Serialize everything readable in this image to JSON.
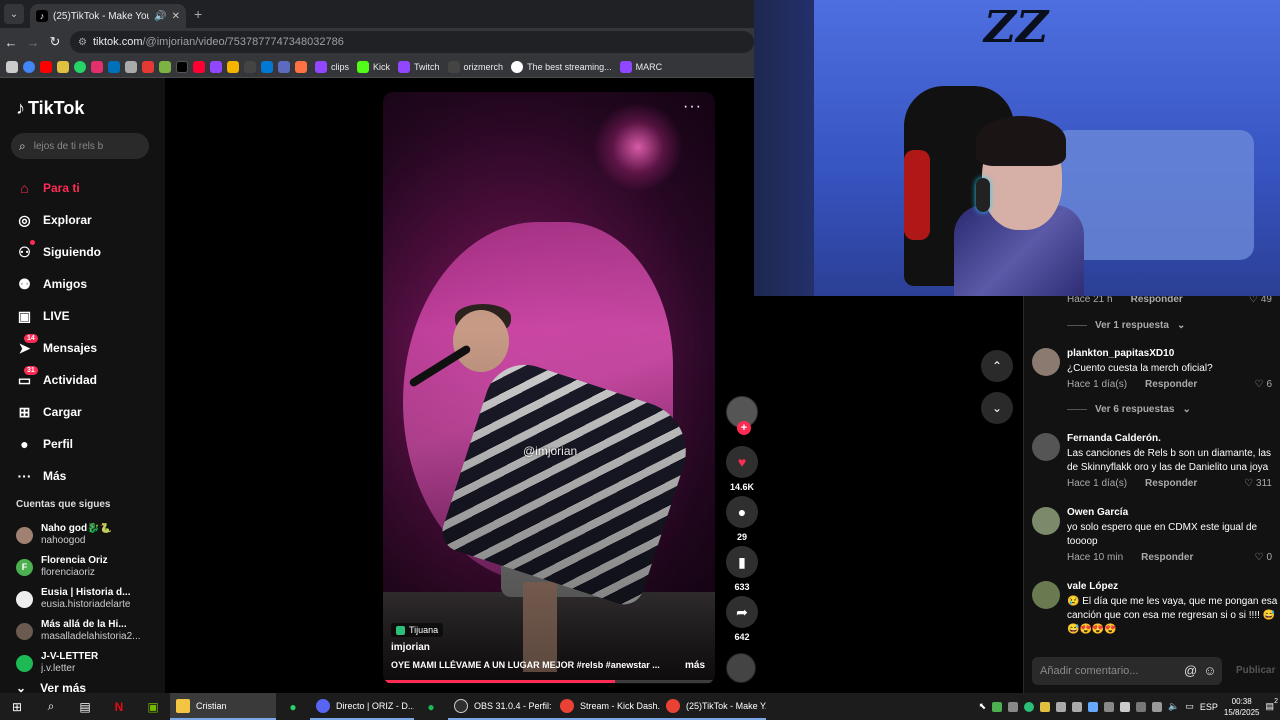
{
  "browser": {
    "tab_title": "(25)TikTok - Make Your Day",
    "url_main": "tiktok.com",
    "url_rest": "/@imjorian/video/7537877747348032786",
    "bookmarks": [
      "clips",
      "Kick",
      "Twitch",
      "orizmerch",
      "The best streaming...",
      "MARC"
    ]
  },
  "sidebar": {
    "logo": "TikTok",
    "search_placeholder": "lejos de ti rels b",
    "nav": [
      {
        "label": "Para ti",
        "icon": "home-icon"
      },
      {
        "label": "Explorar",
        "icon": "compass-icon"
      },
      {
        "label": "Siguiendo",
        "icon": "following-icon"
      },
      {
        "label": "Amigos",
        "icon": "friends-icon"
      },
      {
        "label": "LIVE",
        "icon": "live-icon"
      },
      {
        "label": "Mensajes",
        "icon": "messages-icon",
        "badge": "14"
      },
      {
        "label": "Actividad",
        "icon": "activity-icon",
        "badge": "31"
      },
      {
        "label": "Cargar",
        "icon": "upload-icon"
      },
      {
        "label": "Perfil",
        "icon": "profile-icon"
      },
      {
        "label": "Más",
        "icon": "more-icon"
      }
    ],
    "following_title": "Cuentas que sigues",
    "following": [
      {
        "name": "Naho god🐉🐍",
        "handle": "nahoogod",
        "color": "#a08070"
      },
      {
        "name": "Florencia Oriz",
        "handle": "florenciaoriz",
        "color": "#4caf50",
        "initial": "F"
      },
      {
        "name": "Eusia | Historia d...",
        "handle": "eusia.historiadelarte",
        "color": "#eeeeee"
      },
      {
        "name": "Más allá de la Hi...",
        "handle": "masalladelahistoria2...",
        "color": "#6a5a50"
      },
      {
        "name": "J-V-LETTER",
        "handle": "j.v.letter",
        "color": "#1db954"
      }
    ],
    "see_more": "Ver más"
  },
  "video": {
    "watermark": "@imjorian",
    "location": "Tijuana",
    "author": "imjorian",
    "caption": "OYE MAMI LLÉVAME A UN LUGAR MEJOR #relsb #anewstar ...",
    "more": "más",
    "progress": 0.7
  },
  "actions": {
    "likes": "14.6K",
    "comments": "29",
    "saves": "633",
    "shares": "642"
  },
  "comments": {
    "top_meta": {
      "time": "Hace 21 h",
      "reply": "Responder",
      "likes": "49"
    },
    "view_replies_1": "Ver 1 respuesta",
    "items": [
      {
        "user": "plankton_papitasXD10",
        "text": "¿Cuento cuesta la merch oficial?",
        "time": "Hace 1 día(s)",
        "reply": "Responder",
        "likes": "6"
      },
      {
        "user": "Fernanda Calderón.",
        "text": "Las canciones de Rels b son un diamante, las de Skinnyflakk oro y las de Danielito una joya",
        "time": "Hace 1 día(s)",
        "reply": "Responder",
        "likes": "311"
      },
      {
        "user": "Owen García",
        "text": "yo solo espero que en CDMX este igual de toooop",
        "time": "Hace 10 min",
        "reply": "Responder",
        "likes": "0"
      },
      {
        "user": "vale López",
        "text": "😢 El día que me les vaya, que me pongan esa canción que con esa me regresan si o si !!!! 😅😅😍😍😍",
        "time": "",
        "reply": "",
        "likes": ""
      }
    ],
    "view_replies_6": "Ver 6 respuestas",
    "input_placeholder": "Añadir comentario...",
    "publish": "Publicar"
  },
  "taskbar": {
    "apps": [
      "Cristian",
      "Directo | ORIZ - D...",
      "OBS 31.0.4 - Perfil: ...",
      "Stream - Kick Dash...",
      "(25)TikTok - Make Y..."
    ],
    "lang": "ESP",
    "time": "00:38",
    "date": "15/8/2025",
    "notif": "2"
  },
  "webcam": {
    "logo": "ZZ"
  }
}
